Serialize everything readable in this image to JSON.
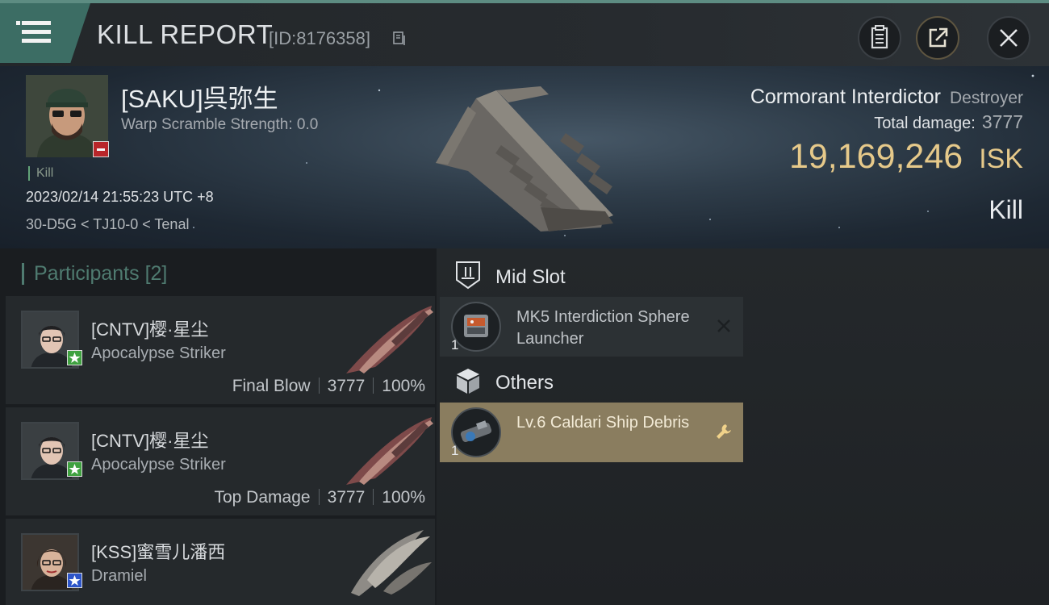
{
  "header": {
    "title": "KILL REPORT",
    "report_id": "[ID:8176358]"
  },
  "victim": {
    "name": "[SAKU]呉弥生",
    "warp_scramble": "Warp Scramble Strength: 0.0",
    "tag": "Kill",
    "timestamp": "2023/02/14 21:55:23 UTC +8",
    "location": "30-D5G < TJ10-0 < Tenal",
    "ship_name": "Cormorant Interdictor",
    "ship_class": "Destroyer",
    "total_damage_label": "Total damage:",
    "total_damage": "3777",
    "isk_value": "19,169,246",
    "isk_unit": "ISK",
    "result": "Kill"
  },
  "participants": {
    "label": "Participants",
    "count": "[2]",
    "rows": [
      {
        "name": "[CNTV]樱·星尘",
        "ship": "Apocalypse Striker",
        "role": "Final Blow",
        "damage": "3777",
        "percent": "100%",
        "star_color": "#3fa140"
      },
      {
        "name": "[CNTV]樱·星尘",
        "ship": "Apocalypse Striker",
        "role": "Top Damage",
        "damage": "3777",
        "percent": "100%",
        "star_color": "#3fa140"
      },
      {
        "name": "[KSS]蜜雪儿潘西",
        "ship": "Dramiel",
        "star_color": "#2d55c9"
      }
    ]
  },
  "modules": {
    "sections": [
      {
        "label": "Mid Slot",
        "icon": "mid-slot-icon",
        "items": [
          {
            "qty": "1",
            "name": "MK5 Interdiction Sphere Launcher",
            "action_icon": "close-icon"
          }
        ]
      },
      {
        "label": "Others",
        "icon": "cube-icon",
        "items": [
          {
            "qty": "1",
            "name": "Lv.6 Caldari Ship Debris",
            "action_icon": "wrench-icon"
          }
        ]
      }
    ]
  },
  "colors": {
    "accent_teal": "#3c6d64",
    "isk_gold": "#e6c98a",
    "highlight_gold": "#8a7d5f",
    "loss_red": "#b8262a"
  }
}
